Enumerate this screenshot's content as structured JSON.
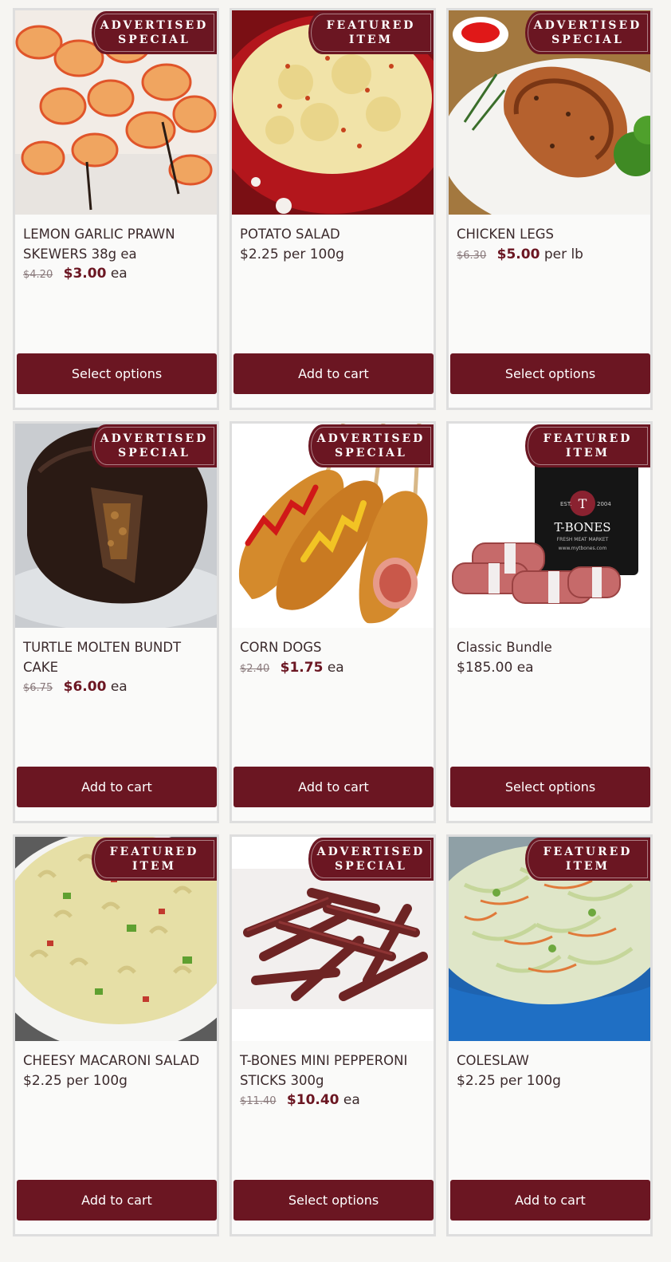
{
  "products": [
    {
      "badge": [
        "ADVERTISED",
        "SPECIAL"
      ],
      "title_lines": [
        "LEMON GARLIC PRAWN",
        "SKEWERS 38g ea"
      ],
      "old_price": "$4.20",
      "price": "$3.00",
      "price_plain": "",
      "unit": "ea",
      "button": "Select options",
      "image": "prawn-skewers-photo"
    },
    {
      "badge": [
        "FEATURED",
        "ITEM"
      ],
      "title_lines": [
        "POTATO SALAD"
      ],
      "old_price": "",
      "price": "",
      "price_plain": "$2.25",
      "unit": "per 100g",
      "button": "Add to cart",
      "image": "potato-salad-photo"
    },
    {
      "badge": [
        "ADVERTISED",
        "SPECIAL"
      ],
      "title_lines": [
        "CHICKEN LEGS"
      ],
      "old_price": "$6.30",
      "price": "$5.00",
      "price_plain": "",
      "unit": "per lb",
      "button": "Select options",
      "image": "chicken-legs-photo"
    },
    {
      "badge": [
        "ADVERTISED",
        "SPECIAL"
      ],
      "title_lines": [
        "TURTLE MOLTEN BUNDT",
        "CAKE"
      ],
      "old_price": "$6.75",
      "price": "$6.00",
      "price_plain": "",
      "unit": "ea",
      "button": "Add to cart",
      "image": "bundt-cake-photo"
    },
    {
      "badge": [
        "ADVERTISED",
        "SPECIAL"
      ],
      "title_lines": [
        "CORN DOGS"
      ],
      "old_price": "$2.40",
      "price": "$1.75",
      "price_plain": "",
      "unit": "ea",
      "button": "Add to cart",
      "image": "corn-dogs-photo"
    },
    {
      "badge": [
        "FEATURED",
        "ITEM"
      ],
      "title_lines": [
        "Classic Bundle"
      ],
      "old_price": "",
      "price": "",
      "price_plain": "$185.00",
      "unit": "ea",
      "button": "Select options",
      "image": "t-bones-bundle-photo",
      "bag_text": [
        "EST.",
        "2004",
        "T-BONES",
        "FRESH MEAT MARKET",
        "www.mytbones.com"
      ]
    },
    {
      "badge": [
        "FEATURED",
        "ITEM"
      ],
      "title_lines": [
        "CHEESY MACARONI SALAD"
      ],
      "old_price": "",
      "price": "",
      "price_plain": "$2.25",
      "unit": "per 100g",
      "button": "Add to cart",
      "image": "macaroni-salad-photo"
    },
    {
      "badge": [
        "ADVERTISED",
        "SPECIAL"
      ],
      "title_lines": [
        "T-BONES MINI PEPPERONI",
        "STICKS 300g"
      ],
      "old_price": "$11.40",
      "price": "$10.40",
      "price_plain": "",
      "unit": "ea",
      "button": "Select options",
      "image": "pepperoni-sticks-photo"
    },
    {
      "badge": [
        "FEATURED",
        "ITEM"
      ],
      "title_lines": [
        "COLESLAW"
      ],
      "old_price": "",
      "price": "",
      "price_plain": "$2.25",
      "unit": "per 100g",
      "button": "Add to cart",
      "image": "coleslaw-photo"
    }
  ],
  "colors": {
    "brand": "#6b1622",
    "card_border": "#dedede",
    "background": "#f6f5f2"
  }
}
